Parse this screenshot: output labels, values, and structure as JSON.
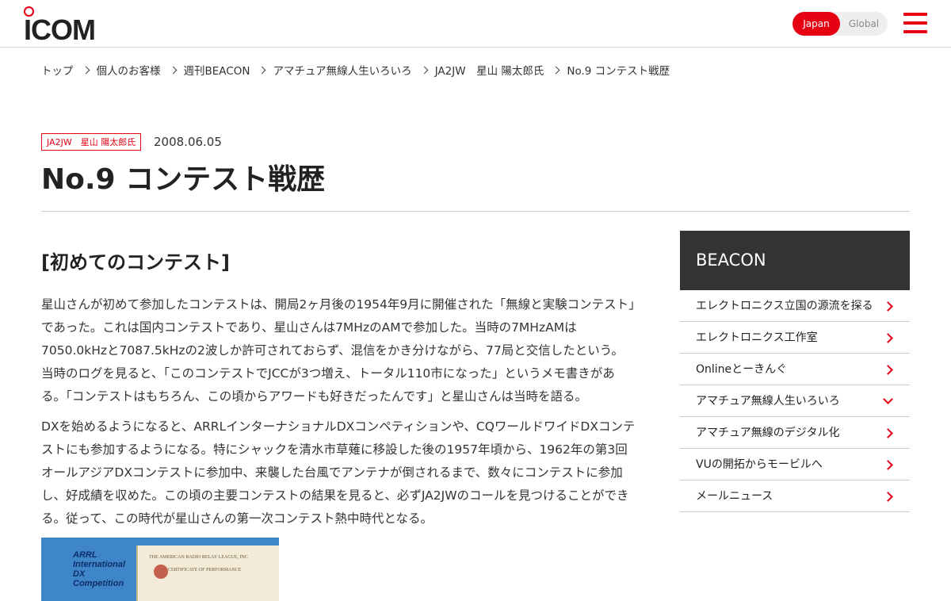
{
  "header": {
    "logo_text": "ICOM",
    "lang_active": "Japan",
    "lang_other": "Global"
  },
  "breadcrumb": [
    "トップ",
    "個人のお客様",
    "週刊BEACON",
    "アマチュア無線人生いろいろ",
    "JA2JW　星山 陽太郎氏",
    "No.9 コンテスト戦歴"
  ],
  "article": {
    "tag": "JA2JW　星山 陽太郎氏",
    "date": "2008.06.05",
    "title": "No.9 コンテスト戦歴",
    "section_heading": "[初めてのコンテスト]",
    "paragraph_1": "星山さんが初めて参加したコンテストは、開局2ヶ月後の1954年9月に開催された「無線と実験コンテスト」であった。これは国内コンテストであり、星山さんは7MHzのAMで参加した。当時の7MHzAMは7050.0kHzと7087.5kHzの2波しか許可されておらず、混信をかき分けながら、77局と交信したという。当時のログを見ると、「このコンテストでJCCが3つ増え、トータル110市になった」というメモ書きがある。「コンテストはもちろん、この頃からアワードも好きだったんです」と星山さんは当時を語る。",
    "paragraph_2": "DXを始めるようになると、ARRLインターナショナルDXコンペティションや、CQワールドワイドDXコンテストにも参加するようになる。特にシャックを清水市草薙に移設した後の1957年頃から、1962年の第3回オールアジアDXコンテストに参加中、来襲した台風でアンテナが倒されるまで、数々にコンテストに参加し、好成績を収めた。この頃の主要コンテストの結果を見ると、必ずJA2JWのコールを見つけることができる。従って、この時代が星山さんの第一次コンテスト熱中時代となる。",
    "photo_cert1_text": "ARRL International DX Competition",
    "photo_cert2_text": "THE AMERICAN RADIO RELAY LEAGUE, INC",
    "photo_cert2_sub": "CERTIFICATE OF PERFORMANCE"
  },
  "sidebar": {
    "heading": "BEACON",
    "items": [
      {
        "label": "エレクトロニクス立国の源流を探る",
        "expanded": false
      },
      {
        "label": "エレクトロニクス工作室",
        "expanded": false
      },
      {
        "label": "Onlineとーきんぐ",
        "expanded": false
      },
      {
        "label": "アマチュア無線人生いろいろ",
        "expanded": true
      },
      {
        "label": "アマチュア無線のデジタル化",
        "expanded": false
      },
      {
        "label": "VUの開拓からモービルへ",
        "expanded": false
      },
      {
        "label": "メールニュース",
        "expanded": false
      }
    ]
  },
  "colors": {
    "accent": "#e60012",
    "sidebar_head": "#333333"
  }
}
